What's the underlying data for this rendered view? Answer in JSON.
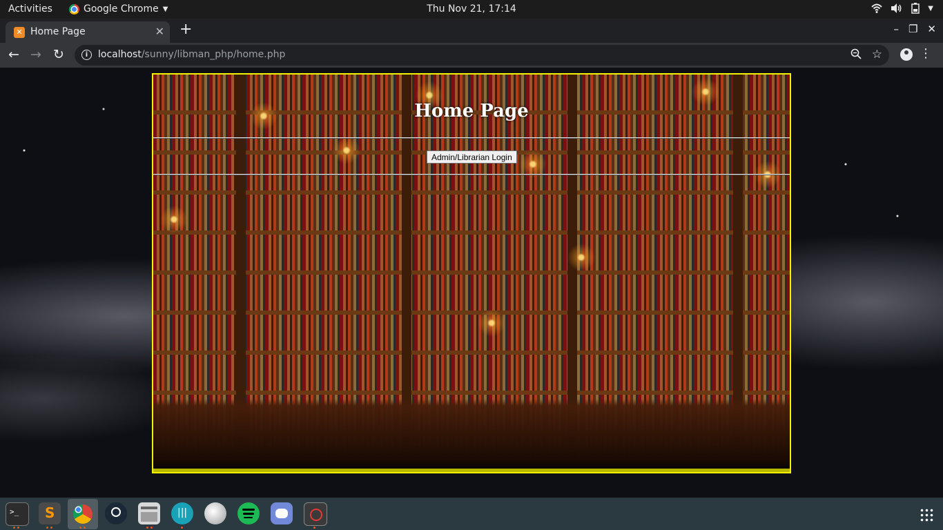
{
  "topbar": {
    "activities": "Activities",
    "app_name": "Google Chrome",
    "clock": "Thu Nov 21, 17:14"
  },
  "browser": {
    "tab_title": "Home Page",
    "url_host": "localhost",
    "url_path": "/sunny/libman_php/home.php"
  },
  "page": {
    "heading": "Home Page",
    "login_button": "Admin/Librarian Login"
  },
  "dock": {
    "items": [
      "terminal",
      "sublime-text",
      "google-chrome",
      "steam",
      "file-archive",
      "stremio",
      "baseball-app",
      "spotify",
      "discord",
      "screen-recorder"
    ]
  },
  "colors": {
    "frame_border": "#f2f200",
    "heading_text": "#ffffff",
    "topbar_bg": "#1c1c1c",
    "dock_bg": "#2b3a40"
  }
}
